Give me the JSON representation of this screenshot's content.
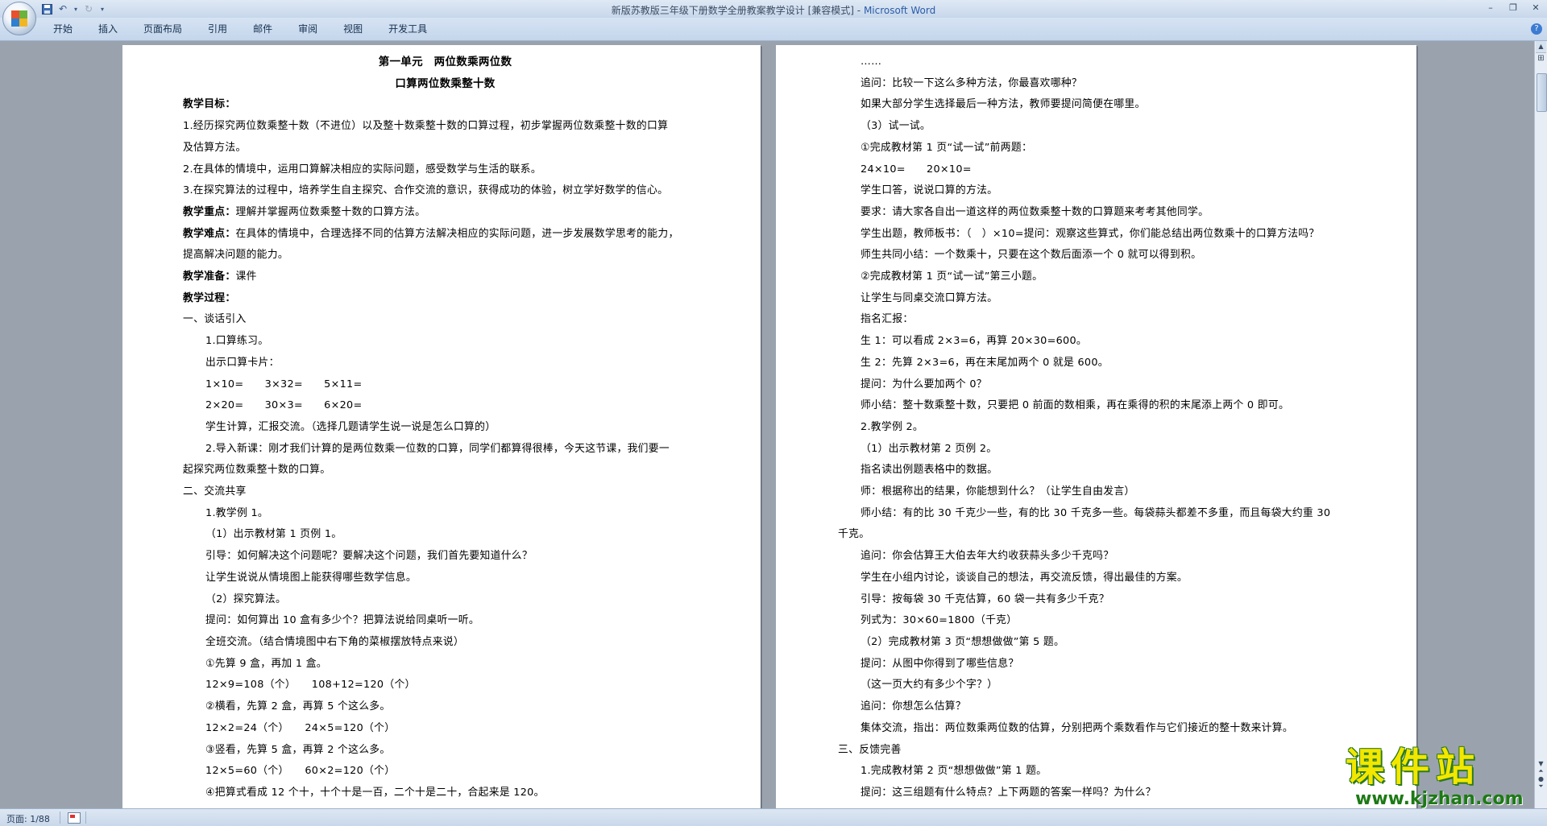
{
  "window": {
    "title": "新版苏教版三年级下册数学全册教案教学设计 [兼容模式]",
    "title_sep": " - ",
    "app_name": "Microsoft Word",
    "controls": [
      "–",
      "❐",
      "✕"
    ]
  },
  "quick_access": [
    "save-icon",
    "undo-icon",
    "redo-icon",
    "customize-icon"
  ],
  "ribbon_tabs": [
    "开始",
    "插入",
    "页面布局",
    "引用",
    "邮件",
    "审阅",
    "视图",
    "开发工具"
  ],
  "status": {
    "page": "页面: 1/88"
  },
  "watermark": {
    "title": "课件站",
    "url": "www.kjzhan.com"
  },
  "colors": {
    "titlebar": "#c7d7eb",
    "workspace": "#9aa3ad",
    "app_name": "#2b5ca8",
    "watermark_yellow": "#f3e700",
    "watermark_green": "#1d7a15"
  },
  "left_page": {
    "lines": [
      "第一单元　两位数乘两位数",
      "口算两位数乘整十数",
      "教学目标：",
      "1.经历探究两位数乘整十数（不进位）以及整十数乘整十数的口算过程，初步掌握两位数乘整十数的口算",
      "及估算方法。",
      "2.在具体的情境中，运用口算解决相应的实际问题，感受数学与生活的联系。",
      "3.在探究算法的过程中，培养学生自主探究、合作交流的意识，获得成功的体验，树立学好数学的信心。",
      "教学重点：",
      "理解并掌握两位数乘整十数的口算方法。",
      "教学难点：",
      "在具体的情境中，合理选择不同的估算方法解决相应的实际问题，进一步发展数学思考的能力，",
      "提高解决问题的能力。",
      "教学准备：",
      "课件",
      "教学过程：",
      "一、谈话引入",
      "1.口算练习。",
      "出示口算卡片：",
      "1×10=　　3×32=　　5×11=",
      "2×20=　　30×3=　　6×20=",
      "学生计算，汇报交流。（选择几题请学生说一说是怎么口算的）",
      "2.导入新课：刚才我们计算的是两位数乘一位数的口算，同学们都算得很棒，今天这节课，我们要一",
      "起探究两位数乘整十数的口算。",
      "二、交流共享",
      "1.教学例 1。",
      "（1）出示教材第 1 页例 1。",
      "引导：如何解决这个问题呢？要解决这个问题，我们首先要知道什么？",
      "让学生说说从情境图上能获得哪些数学信息。",
      "（2）探究算法。",
      "提问：如何算出 10 盒有多少个？把算法说给同桌听一听。",
      "全班交流。（结合情境图中右下角的菜椒摆放特点来说）",
      "①先算 9 盒，再加 1 盒。",
      "12×9=108（个）　　108+12=120（个）",
      "②横看，先算 2 盒，再算 5 个这么多。",
      "12×2=24（个）　　24×5=120（个）",
      "③竖看，先算 5 盒，再算 2 个这么多。",
      "12×5=60（个）　　60×2=120（个）",
      "④把算式看成 12 个十，十个十是一百，二个十是二十，合起来是 120。"
    ]
  },
  "right_page": {
    "lines": [
      "……",
      "追问：比较一下这么多种方法，你最喜欢哪种？",
      "如果大部分学生选择最后一种方法，教师要提问简便在哪里。",
      "（3）试一试。",
      "①完成教材第 1 页“试一试”前两题：",
      "24×10=　　20×10=",
      "学生口答，说说口算的方法。",
      "要求：请大家各自出一道这样的两位数乘整十数的口算题来考考其他同学。",
      "学生出题，教师板书：（　）×10=提问：观察这些算式，你们能总结出两位数乘十的口算方法吗？",
      "师生共同小结：一个数乘十，只要在这个数后面添一个 0 就可以得到积。",
      "②完成教材第 1 页“试一试”第三小题。",
      "让学生与同桌交流口算方法。",
      "指名汇报：",
      "生 1：可以看成 2×3=6，再算 20×30=600。",
      "生 2：先算 2×3=6，再在末尾加两个 0 就是 600。",
      "提问：为什么要加两个 0？",
      "师小结：整十数乘整十数，只要把 0 前面的数相乘，再在乘得的积的末尾添上两个 0 即可。",
      "2.教学例 2。",
      "（1）出示教材第 2 页例 2。",
      "指名读出例题表格中的数据。",
      "师：根据称出的结果，你能想到什么？（让学生自由发言）",
      "师小结：有的比 30 千克少一些，有的比 30 千克多一些。每袋蒜头都差不多重，而且每袋大约重 30",
      "千克。",
      "追问：你会估算王大伯去年大约收获蒜头多少千克吗？",
      "学生在小组内讨论，谈谈自己的想法，再交流反馈，得出最佳的方案。",
      "引导：按每袋 30 千克估算，60 袋一共有多少千克？",
      "列式为：30×60=1800（千克）",
      "（2）完成教材第 3 页“想想做做”第 5 题。",
      "提问：从图中你得到了哪些信息？",
      "（这一页大约有多少个字？）",
      "追问：你想怎么估算？",
      "集体交流，指出：两位数乘两位数的估算，分别把两个乘数看作与它们接近的整十数来计算。",
      "三、反馈完善",
      "1.完成教材第 2 页“想想做做”第 1 题。",
      "提问：这三组题有什么特点？上下两题的答案一样吗？为什么？"
    ]
  }
}
